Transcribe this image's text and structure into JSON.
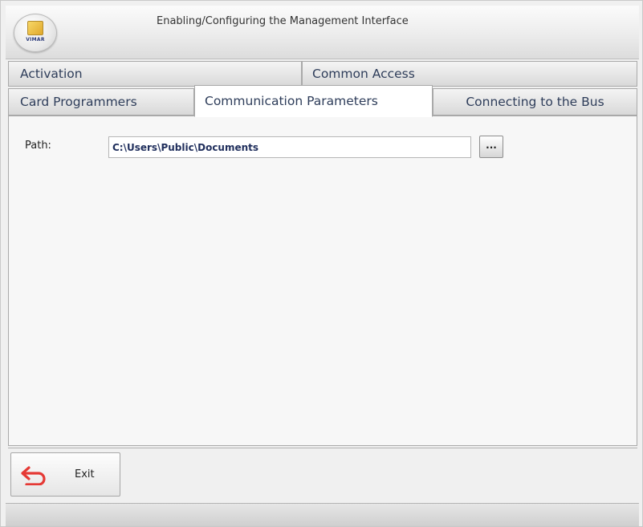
{
  "window": {
    "title": "Enabling/Configuring the Management Interface",
    "logo_text": "VIMAR"
  },
  "tabs": {
    "row1": [
      {
        "label": "Activation"
      },
      {
        "label": "Common Access"
      }
    ],
    "row2": [
      {
        "label": "Card Programmers"
      },
      {
        "label": "Communication Parameters",
        "active": true
      },
      {
        "label": "Connecting to the Bus"
      }
    ]
  },
  "form": {
    "path_label": "Path:",
    "path_value": "C:\\Users\\Public\\Documents",
    "browse_label": "..."
  },
  "footer": {
    "exit_label": "Exit",
    "exit_icon": "undo-arrow-icon",
    "accent_color": "#e53935"
  }
}
